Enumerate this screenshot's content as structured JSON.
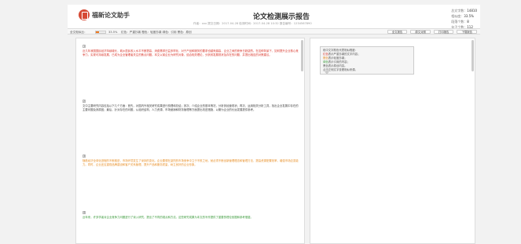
{
  "header": {
    "logo": "福新论文助手",
    "title": "论文检测展示报告",
    "meta": "作者：xxx  提交日期：2017-04-28  检测时间：2017-04-28 10:32  报告编号：1234567890",
    "stats": [
      {
        "label": "总文字数：",
        "value": "14810"
      },
      {
        "label": "相似度：",
        "value": "33.5%"
      },
      {
        "label": "段落个数：",
        "value": "8"
      },
      {
        "label": "句子个数：",
        "value": "112"
      }
    ]
  },
  "toolbar": {
    "label": "全文相似比：",
    "progress": 0.335,
    "percent": "33.5%",
    "legend": "红色：严重抄袭  橙色：轻度抄袭  绿色：引用  黑色：原创",
    "buttons": [
      "全文报告",
      "原文对照",
      "打印报告",
      "下载报告"
    ]
  },
  "doc": {
    "paragraphs": [
      {
        "num": "1",
        "color": "red",
        "text": "近几年我国国民经济持续增长，城乡居民收入水平不断提高，消费需求日益多样化，对于产品和服务的要求也越来越高，企业之间的竞争日趋激烈。在这种背景下，如何提升企业核心竞争力，实现可持续发展，已成为企业管理者关注的焦点问题。本文以某企业为研究对象，结合相关理论，分析其发展现状及存在的问题，并提出相应的对策建议。"
      },
      {
        "num": "2",
        "color": "black",
        "text": "文中主要研究内容包括以下几个方面：首先，对国内外相关研究成果进行梳理和总结；其次，介绍企业的基本情况，分析其经营现状；再次，运用相关分析工具，找出企业发展中存在的主要问题及其原因；最后，针对存在的问题，从组织结构、人力资源、市场营销和财务管理等方面提出改进措施，以期为企业的长远发展提供参考。"
      },
      {
        "num": "3",
        "color": "orange",
        "text": "随着经济全球化进程的不断推进，市场环境发生了深刻的变化。企业要想在激烈的市场竞争中立于不败之地，就必须不断创新管理理念和管理方法，提高资源配置效率，增强市场应变能力。同时，企业还应重视品牌建设和客户关系管理，提升产品和服务质量，树立良好的企业形象。"
      },
      {
        "num": "4",
        "color": "green",
        "text": "近年来，许多学者对企业竞争力问题进行了深入研究，提出了不同的观点和方法。这些研究成果为本文的写作提供了重要的理论依据和参考借鉴。"
      }
    ]
  },
  "side": {
    "lines": [
      {
        "prefix": "",
        "hl": "",
        "hl_color": "",
        "rest": "段中文字颜色代表相似程度："
      },
      {
        "prefix": "",
        "hl": "红色",
        "hl_color": "hl-red",
        "rest": "表示严重抄袭的文字内容；"
      },
      {
        "prefix": "",
        "hl": "橙色",
        "hl_color": "hl-orange",
        "rest": "表示轻度抄袭；"
      },
      {
        "prefix": "",
        "hl": "绿色",
        "hl_color": "hl-green",
        "rest": "表示引用的内容；"
      },
      {
        "prefix": "",
        "hl": "",
        "hl_color": "",
        "rest": "黑色表示原创内容。"
      },
      {
        "prefix": "",
        "hl": "",
        "hl_color": "",
        "rest": "点击左侧文字查看相似来源。"
      }
    ]
  }
}
